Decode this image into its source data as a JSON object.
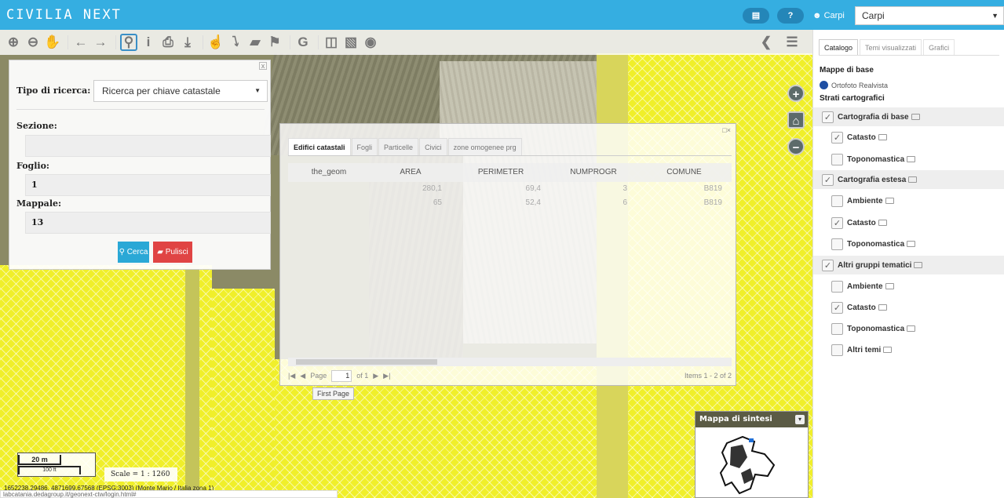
{
  "app": {
    "logo": "CIVILIA NEXT",
    "help_label": "?",
    "user_label": "Carpi",
    "comune_select": "Carpi"
  },
  "toolbar": {
    "tools": [
      "zoom-in-icon",
      "zoom-out-icon",
      "pan-hand-icon",
      "back-arrow-icon",
      "forward-arrow-icon",
      "search-zoom-icon",
      "info-icon",
      "print-icon",
      "download-icon",
      "pointer-icon",
      "lightning-icon",
      "eraser-icon",
      "flag-icon",
      "g-letter-icon",
      "split-view-icon",
      "map-book-icon",
      "globe-icon"
    ],
    "right_tools": [
      "share-icon",
      "list-panel-icon"
    ]
  },
  "search_panel": {
    "close_label": "x",
    "tipo_label": "Tipo di ricerca:",
    "tipo_value": "Ricerca per chiave catastale",
    "sezione_label": "Sezione:",
    "sezione_value": "",
    "foglio_label": "Foglio:",
    "foglio_value": "1",
    "mappale_label": "Mappale:",
    "mappale_value": "13",
    "cerca_label": "Cerca",
    "pulisci_label": "Pulisci",
    "cerca_color": "#2aa8d6",
    "pulisci_color": "#e04444"
  },
  "results": {
    "tabs": [
      "Edifici catastali",
      "Fogli",
      "Particelle",
      "Civici",
      "zone omogenee prg"
    ],
    "columns": [
      "the_geom",
      "AREA",
      "PERIMETER",
      "NUMPROGR",
      "COMUNE"
    ],
    "rows": [
      [
        "",
        "280,1",
        "69,4",
        "3",
        "B819"
      ],
      [
        "",
        "65",
        "52,4",
        "6",
        "B819"
      ]
    ],
    "pager": {
      "page_label": "Page",
      "page_value": "1",
      "of_label": "of 1",
      "items_label": "Items 1 - 2 of 2"
    },
    "tooltip": "First Page"
  },
  "overview": {
    "title": "Mappa di sintesi"
  },
  "scale": {
    "bar_top": "20 m",
    "bar_bottom": "100 ft",
    "text": "Scale = 1 : 1260"
  },
  "coords": "1652238,29486, 4871699,67568 (EPSG:3003) (Monte Mario / Italia zona 1)",
  "status_url": "labcatania.dedagroup.it/geonext-ctw/login.html#",
  "sidebar": {
    "tabs": [
      "Catalogo",
      "Temi visualizzati",
      "Grafici"
    ],
    "base_title": "Mappe di base",
    "base_item": "Ortofoto Realvista",
    "strati_title": "Strati cartografici",
    "layers": [
      {
        "label": "Cartografia di base",
        "checked": true,
        "group": true
      },
      {
        "label": "Catasto",
        "checked": true,
        "group": false
      },
      {
        "label": "Toponomastica",
        "checked": false,
        "group": false
      },
      {
        "label": "Cartografia estesa",
        "checked": true,
        "group": true
      },
      {
        "label": "Ambiente",
        "checked": false,
        "group": false
      },
      {
        "label": "Catasto",
        "checked": true,
        "group": false
      },
      {
        "label": "Toponomastica",
        "checked": false,
        "group": false
      },
      {
        "label": "Altri gruppi tematici",
        "checked": true,
        "group": true
      },
      {
        "label": "Ambiente",
        "checked": false,
        "group": false
      },
      {
        "label": "Catasto",
        "checked": true,
        "group": false
      },
      {
        "label": "Toponomastica",
        "checked": false,
        "group": false
      },
      {
        "label": "Altri temi",
        "checked": false,
        "group": false
      }
    ]
  },
  "colors": {
    "topbar": "#35aee1",
    "hatch_yellow": "#f0ef2a",
    "active_tool": "#3a8fc7"
  }
}
